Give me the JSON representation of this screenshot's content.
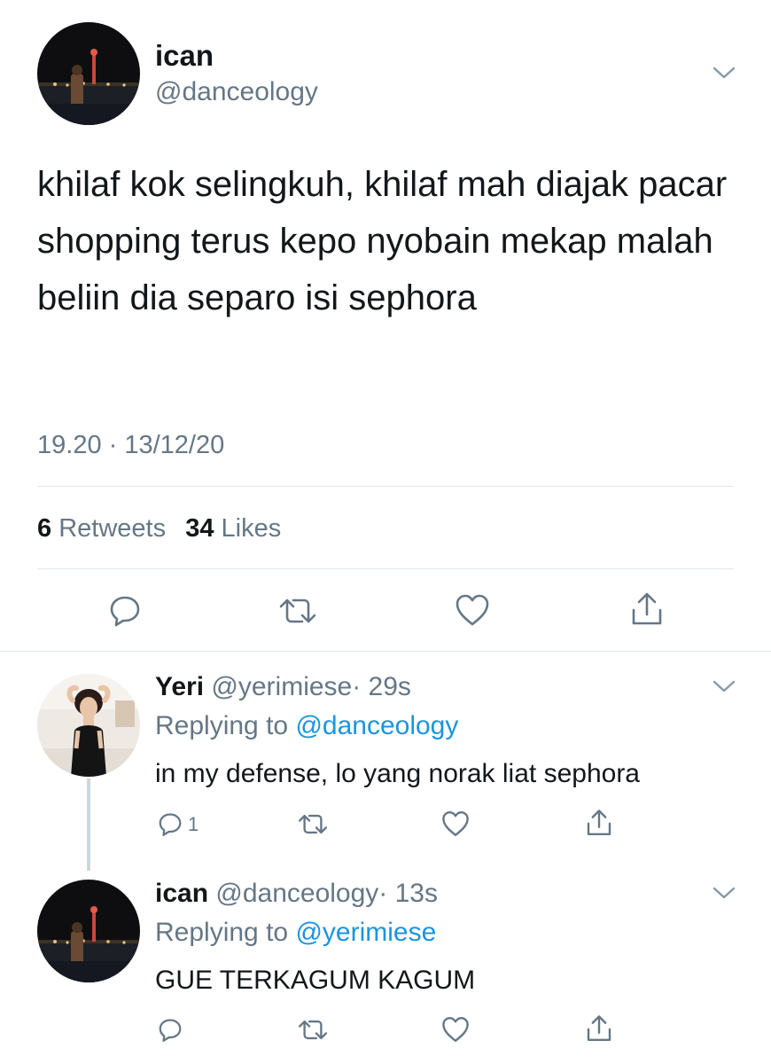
{
  "main_tweet": {
    "display_name": "ican",
    "handle": "@danceology",
    "text": "khilaf kok selingkuh, khilaf mah diajak pacar shopping terus kepo nyobain mekap malah beliin dia separo isi sephora",
    "timestamp": "19.20 · 13/12/20",
    "retweets_count": "6",
    "retweets_label": "Retweets",
    "likes_count": "34",
    "likes_label": "Likes",
    "avatar_icon": "avatar-night-photo"
  },
  "replies": [
    {
      "display_name": "Yeri",
      "handle": "@yerimiese",
      "time": "· 29s",
      "replying_to_label": "Replying to",
      "replying_to_handle": "@danceology",
      "text": "in my defense, lo yang norak liat sephora",
      "reply_count": "1",
      "avatar_icon": "avatar-woman-photo"
    },
    {
      "display_name": "ican",
      "handle": "@danceology",
      "time": "· 13s",
      "replying_to_label": "Replying to",
      "replying_to_handle": "@yerimiese",
      "text": "GUE TERKAGUM KAGUM",
      "avatar_icon": "avatar-night-photo"
    }
  ],
  "icons": {
    "reply": "reply-icon",
    "retweet": "retweet-icon",
    "like": "heart-icon",
    "share": "share-icon",
    "menu": "chevron-down-icon"
  },
  "colors": {
    "text": "#14171a",
    "muted": "#657786",
    "link": "#1b95e0",
    "divider": "#e1e8ed"
  }
}
